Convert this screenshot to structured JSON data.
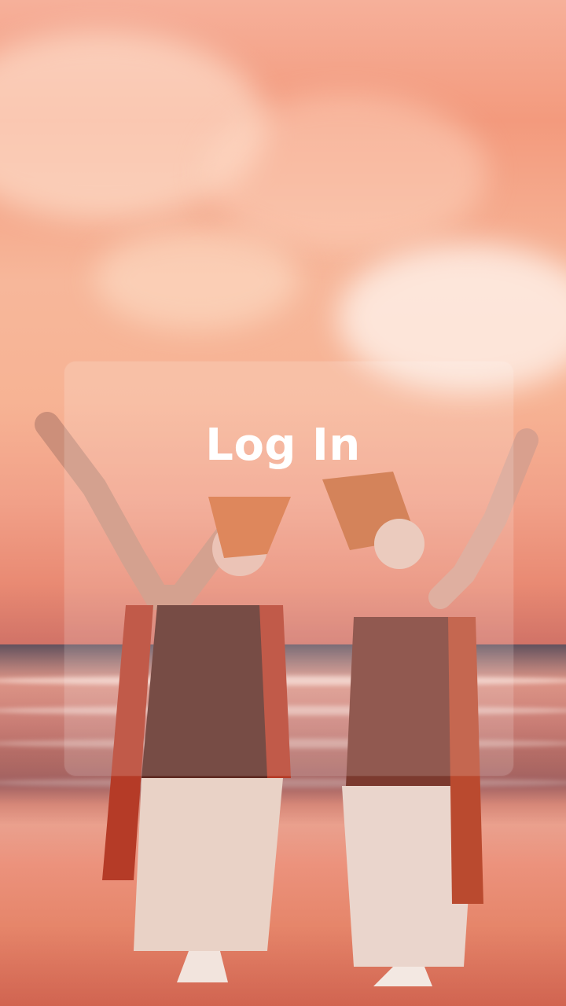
{
  "screen": {
    "title": "Log In",
    "background_image": "sunset-beach-dancers",
    "overlay_color": "#ffffff",
    "accent_color": "#f39a7d"
  }
}
